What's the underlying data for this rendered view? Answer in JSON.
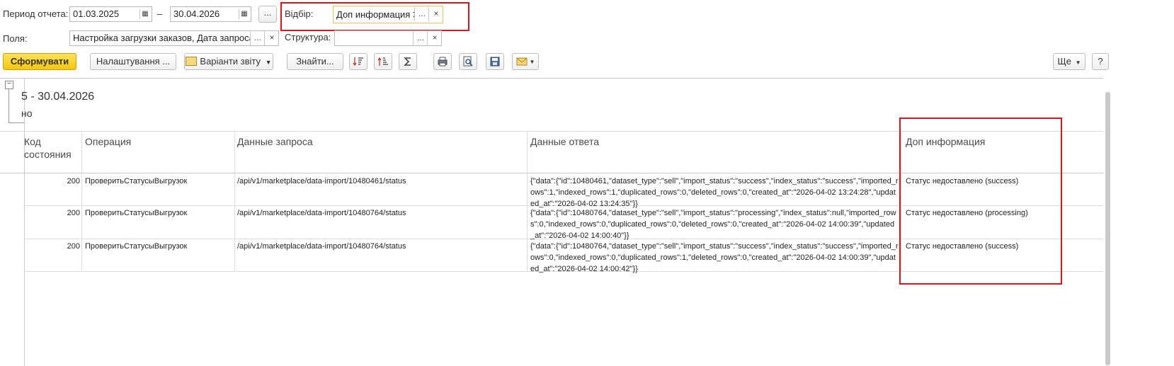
{
  "filters": {
    "period_label": "Период отчета:",
    "date_from": "01.03.2025",
    "dash": "–",
    "date_to": "30.04.2026",
    "more": "...",
    "selection_label": "Відбір:",
    "selection_value": "Доп информация З",
    "selection_more": "...",
    "clear": "×",
    "fields_label": "Поля:",
    "fields_value": "Настройка загрузки заказов, Дата запроса,",
    "fields_more": "...",
    "fields_clear": "×",
    "structure_label": "Структура:",
    "structure_value": "",
    "structure_more": "...",
    "structure_clear": "×"
  },
  "toolbar": {
    "generate": "Сформувати",
    "settings": "Налаштування ...",
    "variants": "Варіанти звіту",
    "find": "Знайти...",
    "more": "Ще",
    "help": "?"
  },
  "report": {
    "period_text": "5 - 30.04.2026",
    "sub_text": "но",
    "headers": {
      "code": "Код\nсостояния",
      "operation": "Операция",
      "request": "Данные запроса",
      "response": "Данные ответа",
      "extra": "Доп информация"
    },
    "rows": [
      {
        "code": "200",
        "operation": "ПроверитьСтатусыВыгрузок",
        "request": "/api/v1/marketplace/data-import/10480461/status",
        "response": "{\"data\":{\"id\":10480461,\"dataset_type\":\"sell\",\"import_status\":\"success\",\"index_status\":\"success\",\"imported_rows\":1,\"indexed_rows\":1,\"duplicated_rows\":0,\"deleted_rows\":0,\"created_at\":\"2026-04-02 13:24:28\",\"updated_at\":\"2026-04-02 13:24:35\"}}",
        "extra": "Статус недоставлено (success)"
      },
      {
        "code": "200",
        "operation": "ПроверитьСтатусыВыгрузок",
        "request": "/api/v1/marketplace/data-import/10480764/status",
        "response": "{\"data\":{\"id\":10480764,\"dataset_type\":\"sell\",\"import_status\":\"processing\",\"index_status\":null,\"imported_rows\":0,\"indexed_rows\":0,\"duplicated_rows\":0,\"deleted_rows\":0,\"created_at\":\"2026-04-02 14:00:39\",\"updated_at\":\"2026-04-02 14:00:40\"}}",
        "extra": "Статус недоставлено (processing)"
      },
      {
        "code": "200",
        "operation": "ПроверитьСтатусыВыгрузок",
        "request": "/api/v1/marketplace/data-import/10480764/status",
        "response": "{\"data\":{\"id\":10480764,\"dataset_type\":\"sell\",\"import_status\":\"success\",\"index_status\":\"success\",\"imported_rows\":0,\"indexed_rows\":0,\"duplicated_rows\":1,\"deleted_rows\":0,\"created_at\":\"2026-04-02 14:00:39\",\"updated_at\":\"2026-04-02 14:00:42\"}}",
        "extra": "Статус недоставлено (success)"
      }
    ]
  },
  "colors": {
    "highlight": "#e0141b",
    "primary_button": "#f3c60c"
  }
}
